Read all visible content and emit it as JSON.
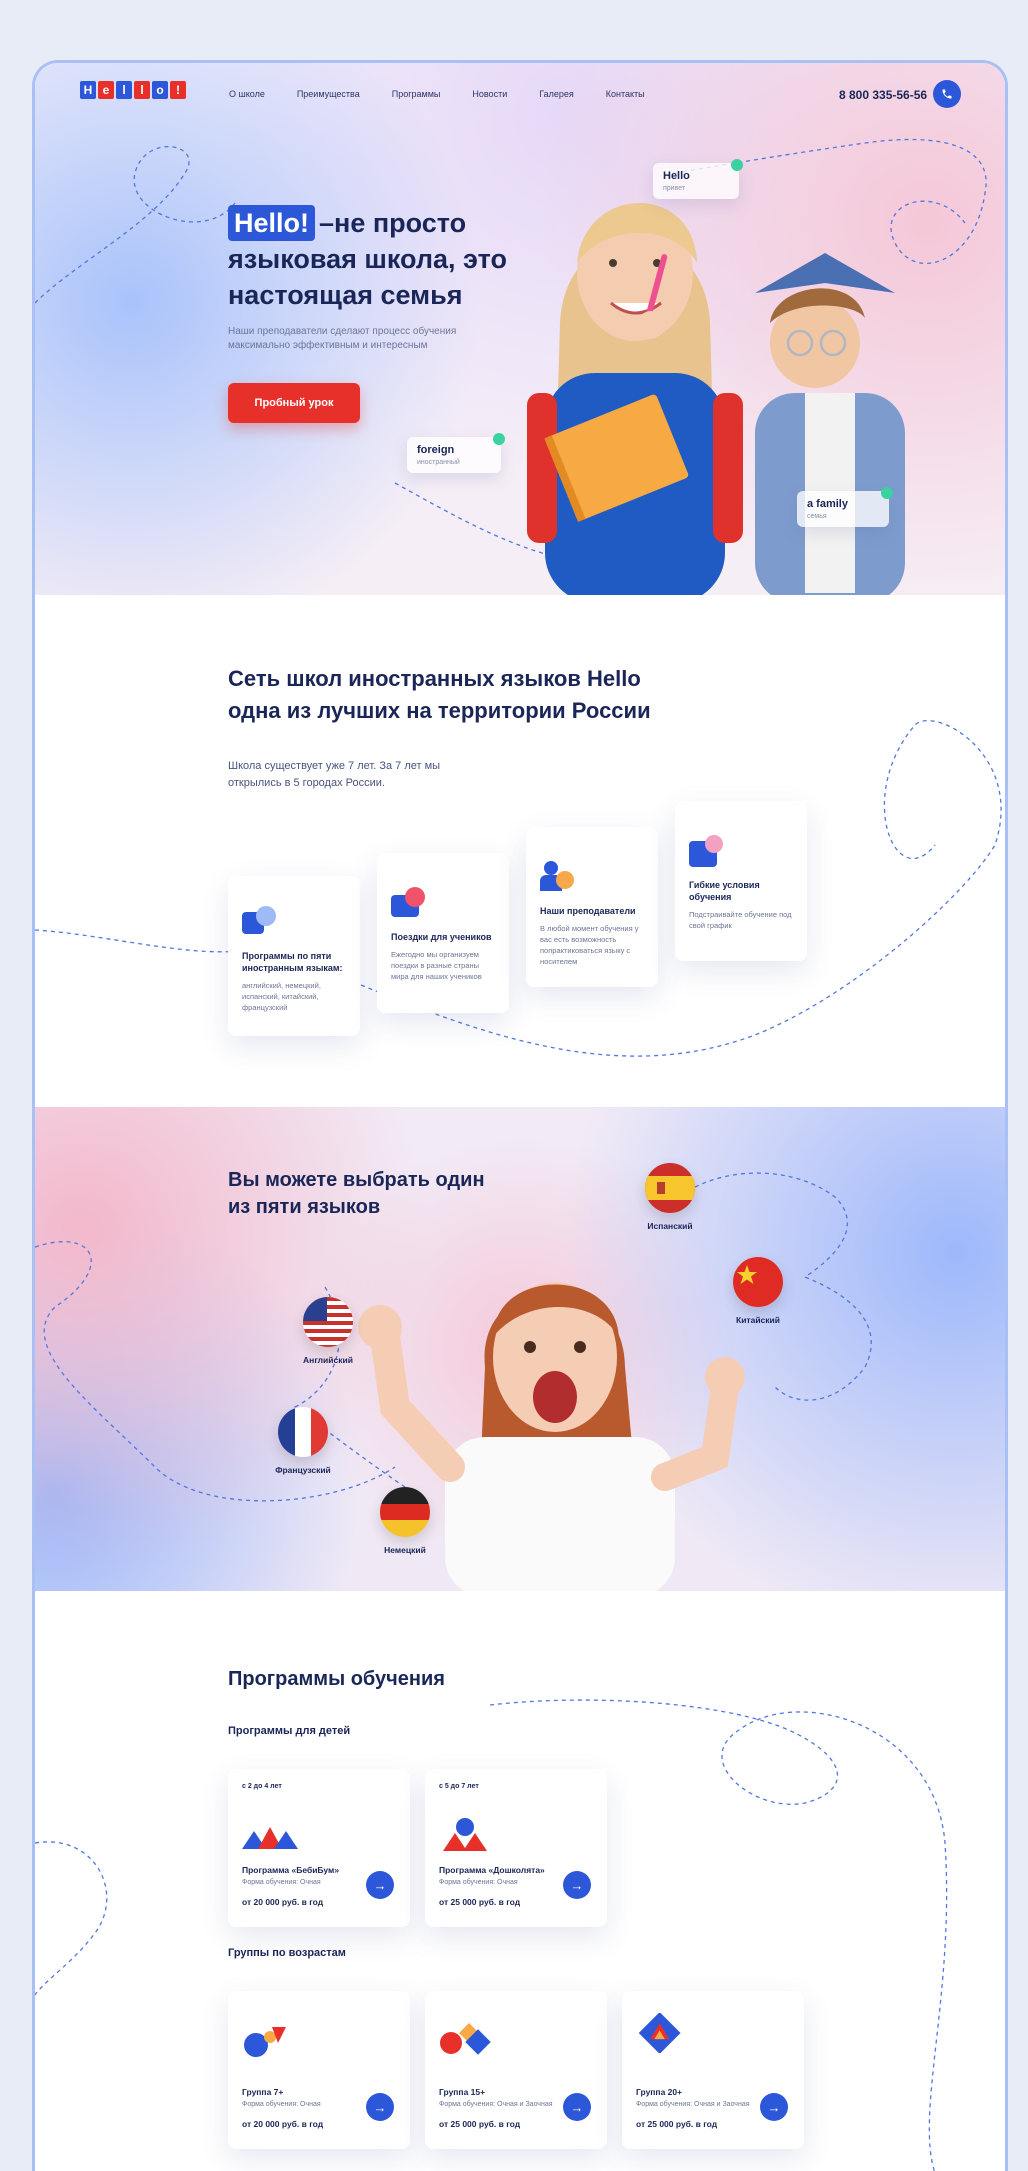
{
  "header": {
    "logo_letters": [
      "H",
      "e",
      "l",
      "l",
      "o",
      "!"
    ],
    "nav": [
      "О школе",
      "Преимущества",
      "Программы",
      "Новости",
      "Галерея",
      "Контакты"
    ],
    "phone": "8 800 335-56-56"
  },
  "hero": {
    "title_chip": "Hello!",
    "title_rest": "–не просто языковая школа, это настоящая семья",
    "subtitle": "Наши преподаватели сделают процесс обучения максимально эффективным и интересным",
    "cta_label": "Пробный урок",
    "words": [
      {
        "word": "Hello",
        "translation": "привет"
      },
      {
        "word": "foreign",
        "translation": "иностранный"
      },
      {
        "word": "a family",
        "translation": "семья"
      }
    ]
  },
  "about": {
    "title": "Сеть школ иностранных языков Hello одна из лучших на территории России",
    "subtitle": "Школа существует уже 7 лет. За 7 лет мы открылись в 5 городах России.",
    "features": [
      {
        "title": "Программы по пяти иностранным языкам:",
        "text": "английский, немецкий, испанский, китайский, французский",
        "icon": "translate-icon"
      },
      {
        "title": "Поездки для учеников",
        "text": "Ежегодно мы организуем поездки в разные страны мира для наших учеников",
        "icon": "suitcase-icon"
      },
      {
        "title": "Наши преподаватели",
        "text": "В любой момент обучения у вас есть возможность попрактиковаться языку с носителем",
        "icon": "teacher-icon"
      },
      {
        "title": "Гибкие условия обучения",
        "text": "Подстраивайте обучение под свой график",
        "icon": "calendar-icon"
      }
    ]
  },
  "languages": {
    "title": "Вы можете выбрать один из пяти языков",
    "items": [
      {
        "label": "Английский",
        "flag": "us-flag-icon"
      },
      {
        "label": "Французский",
        "flag": "france-flag-icon"
      },
      {
        "label": "Немецкий",
        "flag": "germany-flag-icon"
      },
      {
        "label": "Испанский",
        "flag": "spain-flag-icon"
      },
      {
        "label": "Китайский",
        "flag": "china-flag-icon"
      }
    ]
  },
  "programs": {
    "title": "Программы обучения",
    "kids_heading": "Программы для детей",
    "groups_heading": "Группы по возрастам",
    "kids": [
      {
        "age": "с 2 до 4 лет",
        "name": "Программа «БебиБум»",
        "form": "Форма обучения: Очная",
        "price": "от 20 000 руб. в год"
      },
      {
        "age": "с 5 до 7 лет",
        "name": "Программа «Дошколята»",
        "form": "Форма обучения: Очная",
        "price": "от 25 000 руб. в год"
      }
    ],
    "groups": [
      {
        "name": "Группа 7+",
        "form": "Форма обучения: Очная",
        "price": "от 20 000 руб. в год"
      },
      {
        "name": "Группа 15+",
        "form": "Форма обучения: Очная и Заочная",
        "price": "от 25 000 руб. в год"
      },
      {
        "name": "Группа 20+",
        "form": "Форма обучения: Очная и Заочная",
        "price": "от 25 000 руб. в год"
      }
    ]
  },
  "colors": {
    "accent": "#2d57d9",
    "cta": "#e8302a",
    "text": "#1a2657"
  }
}
